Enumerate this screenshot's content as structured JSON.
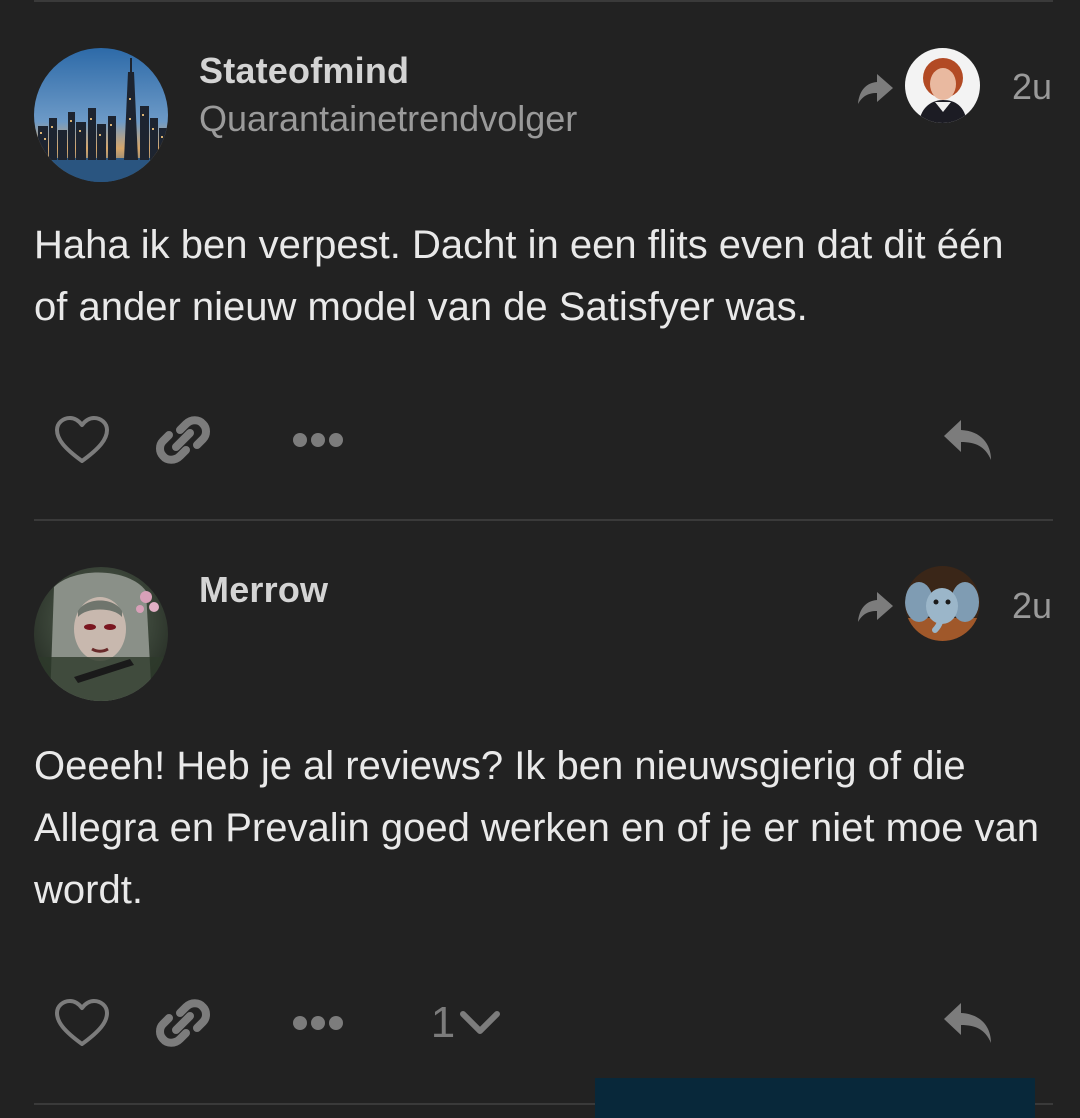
{
  "posts": [
    {
      "username": "Stateofmind",
      "user_title": "Quarantainetrendvolger",
      "time": "2u",
      "body": "Haha ik ben verpest. Dacht in een flits even dat dit één of ander nieuw model van de Satisfyer was.",
      "avatar_icon": "city-skyline-avatar",
      "reply_to_avatar_icon": "woman-portrait-avatar"
    },
    {
      "username": "Merrow",
      "user_title": "",
      "time": "2u",
      "body": "Oeeeh! Heb je al reviews? Ik ben nieuwsgierig of die Allegra en Prevalin goed werken en of je er niet moe van wordt.",
      "reply_count": "1",
      "avatar_icon": "fantasy-character-avatar",
      "reply_to_avatar_icon": "elephant-avatar"
    }
  ],
  "colors": {
    "background": "#222222",
    "text": "#e9e9e9",
    "muted": "#9a9a9a",
    "icon": "#7c7c7c",
    "divider": "#3a3a3a"
  }
}
